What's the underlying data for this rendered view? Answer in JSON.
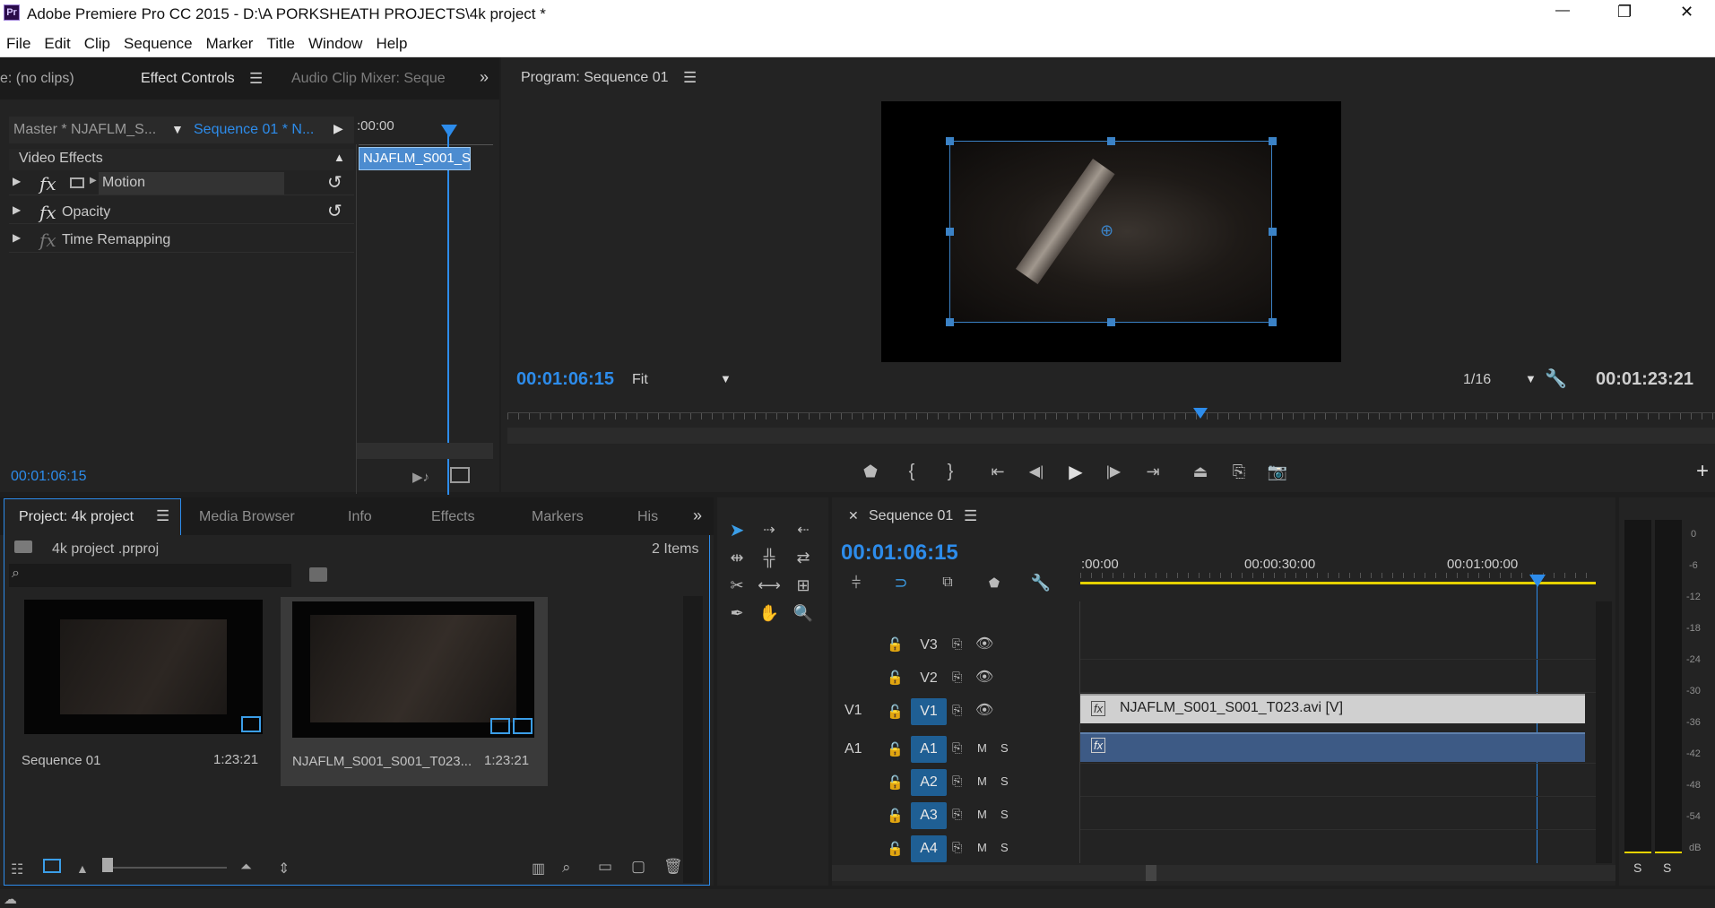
{
  "window": {
    "title": "Adobe Premiere Pro CC 2015 - D:\\A PORKSHEATH PROJECTS\\4k project *",
    "app_icon": "Pr",
    "minimize": "—",
    "restore": "❐",
    "close": "✕"
  },
  "menu": [
    "File",
    "Edit",
    "Clip",
    "Sequence",
    "Marker",
    "Title",
    "Window",
    "Help"
  ],
  "source_panel": {
    "tabs": {
      "source": "e: (no clips)",
      "effect_controls": "Effect Controls",
      "audio_mixer": "Audio Clip Mixer: Seque"
    },
    "master": "Master * NJAFLM_S...",
    "sequence": "Sequence 01 * N...",
    "time0": ":00:00",
    "clip_label": "NJAFLM_S001_S",
    "video_effects": "Video Effects",
    "effects": [
      {
        "label": "Motion"
      },
      {
        "label": "Opacity"
      },
      {
        "label": "Time Remapping"
      }
    ],
    "timecode": "00:01:06:15"
  },
  "program": {
    "title": "Program: Sequence 01",
    "timecode": "00:01:06:15",
    "fit": "Fit",
    "resolution": "1/16",
    "duration": "00:01:23:21"
  },
  "project": {
    "tabs": [
      "Project: 4k project",
      "Media Browser",
      "Info",
      "Effects",
      "Markers",
      "His"
    ],
    "file": "4k project .prproj",
    "items_count": "2 Items",
    "items": [
      {
        "name": "Sequence 01",
        "duration": "1:23:21"
      },
      {
        "name": "NJAFLM_S001_S001_T023...",
        "duration": "1:23:21"
      }
    ]
  },
  "timeline": {
    "tab": "Sequence 01",
    "timecode": "00:01:06:15",
    "ruler": [
      ":00:00",
      "00:00:30:00",
      "00:01:00:00"
    ],
    "video_tracks": [
      {
        "name": "V3",
        "src": ""
      },
      {
        "name": "V2",
        "src": ""
      },
      {
        "name": "V1",
        "src": "V1"
      }
    ],
    "audio_tracks": [
      {
        "name": "A1",
        "src": "A1"
      },
      {
        "name": "A2",
        "src": ""
      },
      {
        "name": "A3",
        "src": ""
      },
      {
        "name": "A4",
        "src": ""
      }
    ],
    "video_clip": "NJAFLM_S001_S001_T023.avi [V]",
    "fx": "fx",
    "mute": "M",
    "solo": "S"
  },
  "meter": {
    "scale": [
      "0",
      "-6",
      "-12",
      "-18",
      "-24",
      "-30",
      "-36",
      "-42",
      "-48",
      "-54",
      "dB"
    ],
    "solo_left": "S",
    "solo_right": "S"
  }
}
